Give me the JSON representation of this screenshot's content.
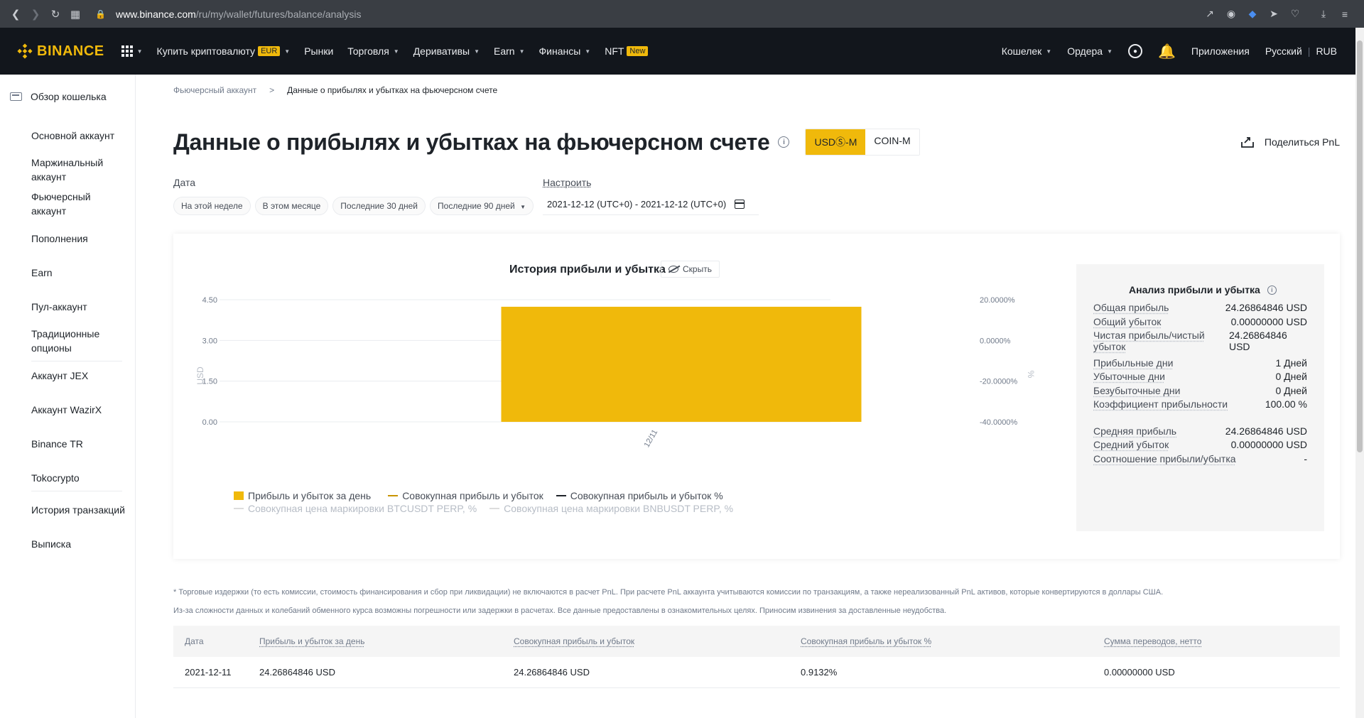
{
  "browser": {
    "url_host": "www.binance.com",
    "url_path": "/ru/my/wallet/futures/balance/analysis"
  },
  "nav": {
    "logo": "BINANCE",
    "buy_crypto": "Купить криптовалюту",
    "buy_tag": "EUR",
    "markets": "Рынки",
    "trade": "Торговля",
    "derivatives": "Деривативы",
    "earn": "Earn",
    "finance": "Финансы",
    "nft": "NFT",
    "nft_tag": "New",
    "wallet": "Кошелек",
    "orders": "Ордера",
    "apps": "Приложения",
    "language": "Русский",
    "currency": "RUB"
  },
  "sidebar": {
    "overview": "Обзор кошелька",
    "items": [
      "Основной аккаунт",
      "Маржинальный аккаунт",
      "Фьючерсный аккаунт",
      "Пополнения",
      "Earn",
      "Пул-аккаунт",
      "Традиционные опционы",
      "Аккаунт JEX",
      "Аккаунт WazirX",
      "Binance TR",
      "Tokocrypto",
      "История транзакций",
      "Выписка"
    ]
  },
  "breadcrumb": {
    "parent": "Фьючерсный аккаунт",
    "sep": ">",
    "current": "Данные о прибылях и убытках на фьючерсном счете"
  },
  "page": {
    "title": "Данные о прибылях и убытках на фьючерсном счете",
    "seg_usd": "USDⓈ-M",
    "seg_coin": "COIN-M",
    "share": "Поделиться PnL"
  },
  "date": {
    "label": "Дата",
    "custom": "Настроить",
    "chips": [
      "На этой неделе",
      "В этом месяце",
      "Последние 30 дней",
      "Последние 90 дней"
    ],
    "range": "2021-12-12 (UTC+0) - 2021-12-12 (UTC+0)"
  },
  "chart": {
    "title": "История прибыли и убытка",
    "hide": "Скрыть"
  },
  "chart_data": {
    "type": "bar",
    "title": "История прибыли и убытка",
    "categories": [
      "12/11"
    ],
    "series": [
      {
        "name": "Прибыль и убыток за день",
        "values": [
          4.24
        ],
        "color": "#f0b90b",
        "axis": "left"
      }
    ],
    "ylabel": "USD",
    "y2label": "%",
    "ylim": [
      0,
      4.5
    ],
    "yticks": [
      "0.00",
      "1.50",
      "3.00",
      "4.50"
    ],
    "y2ticks": [
      "-40.0000%",
      "-20.0000%",
      "0.0000%",
      "20.0000%"
    ],
    "legend": [
      {
        "label": "Прибыль и убыток за день",
        "kind": "bar",
        "color": "#f0b90b"
      },
      {
        "label": "Совокупная прибыль и убыток",
        "kind": "line",
        "color": "#c99400"
      },
      {
        "label": "Совокупная прибыль и убыток %",
        "kind": "line",
        "color": "#1e2329"
      },
      {
        "label": "Совокупная цена маркировки BTCUSDT PERP, %",
        "kind": "line",
        "color": "#dcdcdc",
        "dim": true
      },
      {
        "label": "Совокупная цена маркировки BNBUSDT PERP, %",
        "kind": "line",
        "color": "#dcdcdc",
        "dim": true
      }
    ]
  },
  "analysis": {
    "title": "Анализ прибыли и убытка",
    "rows": [
      {
        "k": "Общая прибыль",
        "v": "24.26864846 USD"
      },
      {
        "k": "Общий убыток",
        "v": "0.00000000 USD"
      },
      {
        "k": "Чистая прибыль/чистый убыток",
        "v": "24.26864846 USD"
      },
      {
        "k": "Прибыльные дни",
        "v": "1 Дней"
      },
      {
        "k": "Убыточные дни",
        "v": "0 Дней"
      },
      {
        "k": "Безубыточные дни",
        "v": "0 Дней"
      },
      {
        "k": "Коэффициент прибыльности",
        "v": "100.00 %"
      },
      {
        "k": "Средняя прибыль",
        "v": "24.26864846 USD"
      },
      {
        "k": "Средний убыток",
        "v": "0.00000000 USD"
      },
      {
        "k": "Соотношение прибыли/убытка",
        "v": "-"
      }
    ]
  },
  "notes": [
    "* Торговые издержки (то есть комиссии, стоимость финансирования и сбор при ликвидации) не включаются в расчет PnL. При расчете PnL аккаунта учитываются комиссии по транзакциям, а также нереализованный PnL активов, которые конвертируются в доллары США.",
    "Из-за сложности данных и колебаний обменного курса возможны погрешности или задержки в расчетах. Все данные предоставлены в ознакомительных целях. Приносим извинения за доставленные неудобства."
  ],
  "table": {
    "headers": [
      "Дата",
      "Прибыль и убыток за день",
      "Совокупная прибыль и убыток",
      "Совокупная прибыль и убыток %",
      "Сумма переводов, нетто"
    ],
    "rows": [
      [
        "2021-12-11",
        "24.26864846 USD",
        "24.26864846 USD",
        "0.9132%",
        "0.00000000 USD"
      ]
    ]
  }
}
